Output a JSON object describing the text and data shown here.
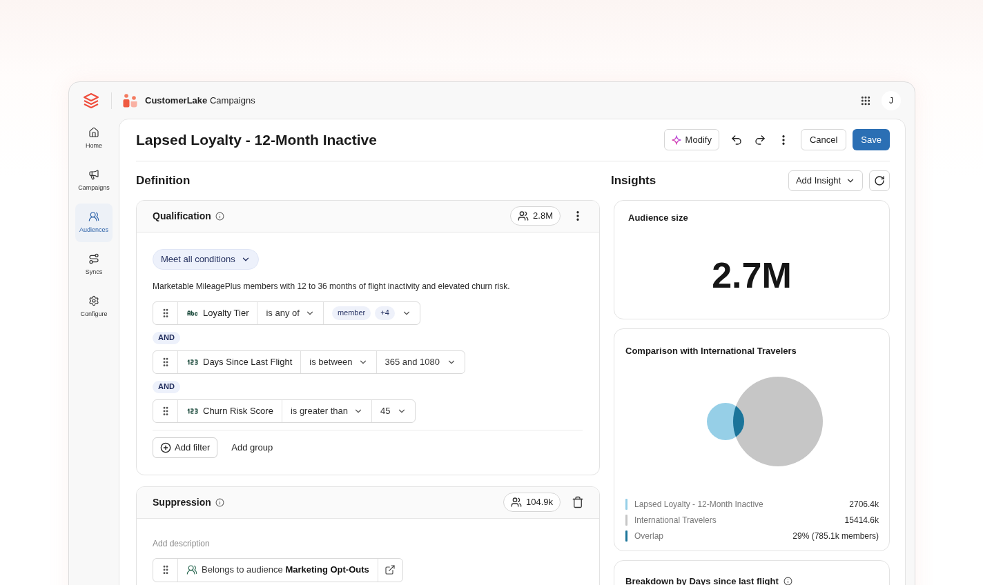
{
  "app_bar": {
    "product": "CustomerLake",
    "product_section": "Campaigns",
    "avatar_initial": "J"
  },
  "sidebar": {
    "items": [
      {
        "label": "Home",
        "selected": false
      },
      {
        "label": "Campaigns",
        "selected": false
      },
      {
        "label": "Audiences",
        "selected": true
      },
      {
        "label": "Syncs",
        "selected": false
      },
      {
        "label": "Configure",
        "selected": false
      }
    ]
  },
  "header": {
    "title": "Lapsed Loyalty - 12-Month Inactive",
    "modify_button": "Modify",
    "cancel_button": "Cancel",
    "save_button": "Save"
  },
  "definition": {
    "heading": "Definition",
    "qualification": {
      "title": "Qualification",
      "count": "2.8M",
      "match_mode": "Meet all conditions",
      "description": "Marketable MileagePlus members with 12 to 36 months of flight inactivity and elevated churn risk.",
      "filters": [
        {
          "kind": "text",
          "field": "Loyalty Tier",
          "operator": "is any of",
          "values": [
            "member",
            "+4"
          ]
        },
        {
          "kind": "number",
          "joiner": "AND",
          "field": "Days Since Last Flight",
          "operator": "is between",
          "value": "365 and 1080"
        },
        {
          "kind": "number",
          "joiner": "AND",
          "field": "Churn Risk Score",
          "operator": "is greater than",
          "value": "45"
        }
      ],
      "add_filter": "Add filter",
      "add_group": "Add group"
    },
    "suppression": {
      "title": "Suppression",
      "count": "104.9k",
      "description": {
        "placeholder": "Add description"
      },
      "rules": [
        {
          "kind": "audience",
          "text": "Belongs to audience **Marketing Opt-Outs**"
        }
      ]
    }
  },
  "insights": {
    "heading": "Insights",
    "add_insight": "Add Insight",
    "audience_size": {
      "title": "Audience size",
      "value": "2.7M"
    },
    "comparison": {
      "title": "Comparison with International Travelers",
      "legend": [
        {
          "label": "Lapsed Loyalty - 12-Month Inactive",
          "value": "2706.4k",
          "color": "#96cfe7"
        },
        {
          "label": "International Travelers",
          "value": "15414.6k",
          "color": "#c6c6c6"
        },
        {
          "label": "Overlap",
          "value": "29% (785.1k members)",
          "color": "#1b7499"
        }
      ]
    },
    "breakdown": {
      "title": "Breakdown by Days since last flight"
    }
  }
}
